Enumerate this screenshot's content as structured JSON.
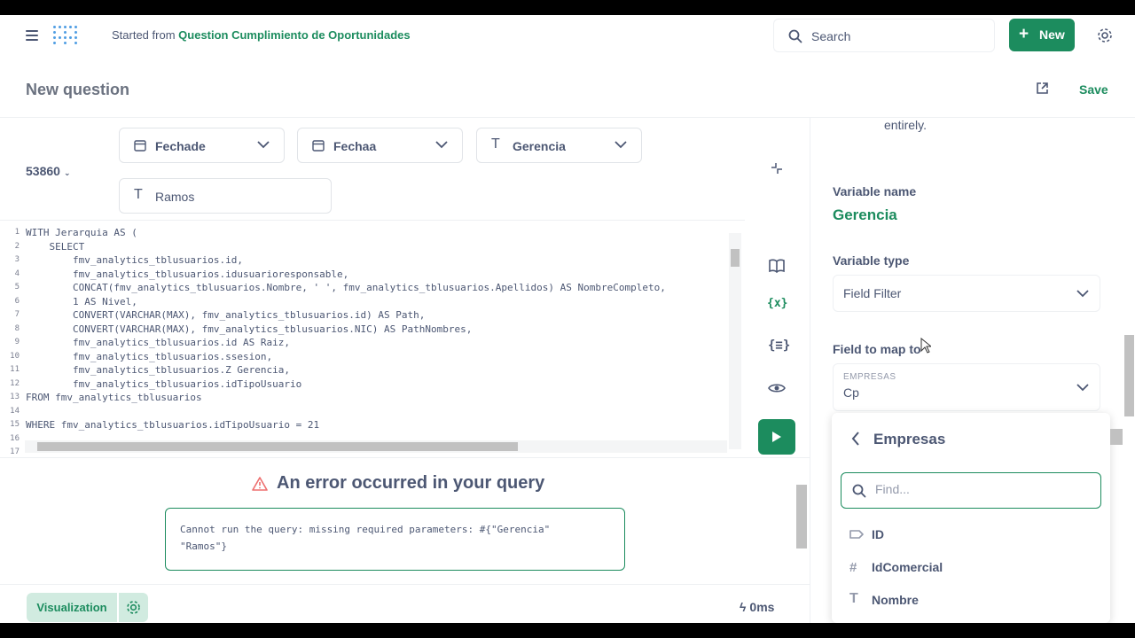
{
  "header": {
    "crumb_prefix": "Started from",
    "crumb_link": "Question Cumplimiento de Oportunidades",
    "search_label": "Search",
    "new_label": "New"
  },
  "question": {
    "title": "New question",
    "save_label": "Save"
  },
  "editor": {
    "database_id": "53860",
    "filters": [
      {
        "label": "Fechade",
        "type": "date"
      },
      {
        "label": "Fechaa",
        "type": "date"
      },
      {
        "label": "Gerencia",
        "type": "text"
      },
      {
        "label": "Ramos",
        "type": "text"
      }
    ],
    "line_numbers": [
      "1",
      "2",
      "3",
      "4",
      "5",
      "6",
      "7",
      "8",
      "9",
      "10",
      "11",
      "12",
      "13",
      "14",
      "15",
      "16",
      "17"
    ],
    "code_lines": [
      "WITH Jerarquia AS (",
      "    SELECT",
      "        fmv_analytics_tblusuarios.id,",
      "        fmv_analytics_tblusuarios.idusuarioresponsable,",
      "        CONCAT(fmv_analytics_tblusuarios.Nombre, ' ', fmv_analytics_tblusuarios.Apellidos) AS NombreCompleto,",
      "        1 AS Nivel,",
      "        CONVERT(VARCHAR(MAX), fmv_analytics_tblusuarios.id) AS Path,",
      "        CONVERT(VARCHAR(MAX), fmv_analytics_tblusuarios.NIC) AS PathNombres,",
      "        fmv_analytics_tblusuarios.id AS Raiz,",
      "        fmv_analytics_tblusuarios.ssesion,",
      "        fmv_analytics_tblusuarios.Z Gerencia,",
      "        fmv_analytics_tblusuarios.idTipoUsuario",
      "FROM fmv_analytics_tblusuarios",
      "",
      "WHERE fmv_analytics_tblusuarios.idTipoUsuario = 21",
      "",
      ""
    ]
  },
  "error": {
    "title": "An error occurred in your query",
    "message_line1": "Cannot run the query: missing required parameters: #{\"Gerencia\"",
    "message_line2": "\"Ramos\"}"
  },
  "footer": {
    "visualization_label": "Visualization",
    "timing": "0ms"
  },
  "sidebar": {
    "entirely_text": "entirely.",
    "variable_name_label": "Variable name",
    "variable_name": "Gerencia",
    "variable_type_label": "Variable type",
    "variable_type": "Field Filter",
    "field_map_label": "Field to map to",
    "field_table_caption": "EMPRESAS",
    "field_value": "Cp"
  },
  "popover": {
    "title": "Empresas",
    "find_placeholder": "Find...",
    "items": [
      {
        "label": "ID",
        "icon": "tag-icon"
      },
      {
        "label": "IdComercial",
        "icon": "hash-icon"
      },
      {
        "label": "Nombre",
        "icon": "text-icon"
      }
    ]
  },
  "colors": {
    "brand": "#1c8c5e",
    "brand_light": "#d1ebe0",
    "text": "#4c5773",
    "error": "#ed6e6e"
  }
}
